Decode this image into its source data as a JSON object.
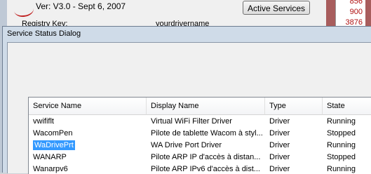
{
  "background": {
    "version_text": "Ver: V3.0  -  Sept 6, 2007",
    "registry_label": "Registry Key:",
    "registry_value": "yourdrivername",
    "active_services_label": "Active Services",
    "numbers": [
      "856",
      "900",
      "3876"
    ]
  },
  "dialog": {
    "title": "Service Status Dialog",
    "columns": [
      "Service Name",
      "Display Name",
      "Type",
      "State"
    ],
    "rows": [
      {
        "name": "vwififlt",
        "display": "Virtual WiFi Filter Driver",
        "type": "Driver",
        "state": "Running"
      },
      {
        "name": "WacomPen",
        "display": "Pilote de tablette Wacom à styl...",
        "type": "Driver",
        "state": "Stopped"
      },
      {
        "name": "WaDrivePrt",
        "display": "WA Drive Port Driver",
        "type": "Driver",
        "state": "Running",
        "selected": true
      },
      {
        "name": "WANARP",
        "display": "Pilote ARP IP d'accès à distan...",
        "type": "Driver",
        "state": "Stopped"
      },
      {
        "name": "Wanarpv6",
        "display": "Pilote ARP IPv6 d'accès à dist...",
        "type": "Driver",
        "state": "Running"
      }
    ]
  },
  "colors": {
    "selection": "#3399ff",
    "accent_strip": "#a85d5d",
    "number_red": "#b01010"
  }
}
